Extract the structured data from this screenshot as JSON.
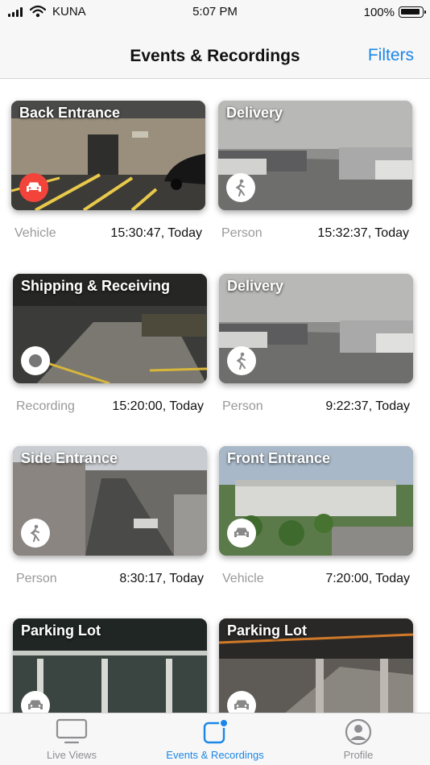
{
  "status_bar": {
    "carrier": "KUNA",
    "time": "5:07 PM",
    "battery": "100%"
  },
  "nav": {
    "title": "Events & Recordings",
    "filters_label": "Filters"
  },
  "events": [
    {
      "camera": "Back Entrance",
      "type": "Vehicle",
      "timestamp": "15:30:47, Today",
      "icon": "car-icon",
      "badge_color": "#f2443a"
    },
    {
      "camera": "Delivery",
      "type": "Person",
      "timestamp": "15:32:37, Today",
      "icon": "person-walking-icon",
      "badge_color": "#ffffff"
    },
    {
      "camera": "Shipping & Receiving",
      "type": "Recording",
      "timestamp": "15:20:00, Today",
      "icon": "record-icon",
      "badge_color": "#ffffff"
    },
    {
      "camera": "Delivery",
      "type": "Person",
      "timestamp": "9:22:37, Today",
      "icon": "person-walking-icon",
      "badge_color": "#ffffff"
    },
    {
      "camera": "Side Entrance",
      "type": "Person",
      "timestamp": "8:30:17, Today",
      "icon": "person-walking-icon",
      "badge_color": "#ffffff"
    },
    {
      "camera": "Front Entrance",
      "type": "Vehicle",
      "timestamp": "7:20:00, Today",
      "icon": "car-icon",
      "badge_color": "#ffffff"
    },
    {
      "camera": "Parking Lot",
      "type": "",
      "timestamp": "",
      "icon": "car-icon",
      "badge_color": "#ffffff"
    },
    {
      "camera": "Parking Lot",
      "type": "",
      "timestamp": "",
      "icon": "car-icon",
      "badge_color": "#ffffff"
    }
  ],
  "tabs": [
    {
      "label": "Live Views",
      "icon": "monitor-icon"
    },
    {
      "label": "Events & Recordings",
      "icon": "events-icon"
    },
    {
      "label": "Profile",
      "icon": "profile-icon"
    }
  ],
  "colors": {
    "accent": "#1a87e8",
    "vehicle_alert": "#f2443a"
  }
}
